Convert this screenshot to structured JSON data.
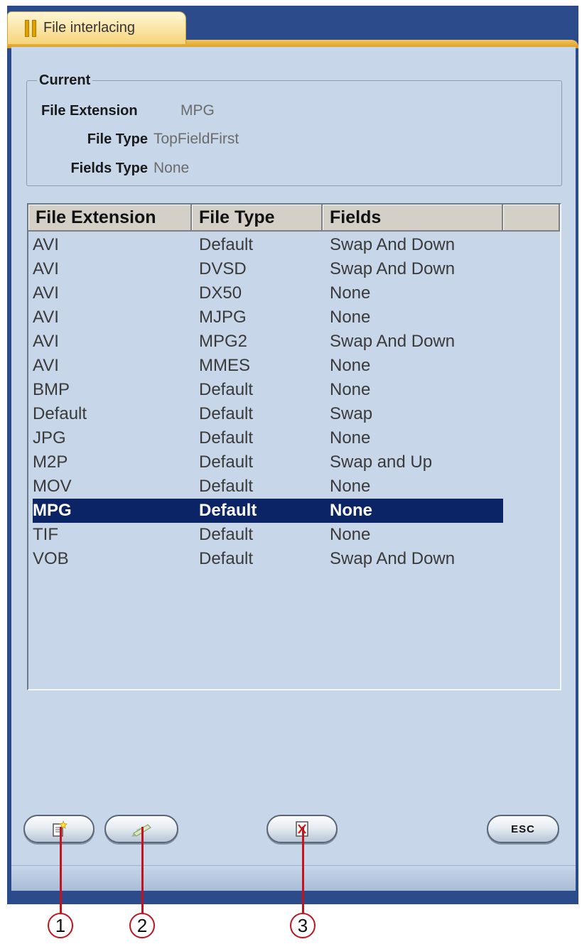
{
  "tab": {
    "title": "File interlacing"
  },
  "current": {
    "legend": "Current",
    "fields": [
      {
        "label": "File Extension",
        "value": "MPG"
      },
      {
        "label": "File Type",
        "value": "TopFieldFirst"
      },
      {
        "label": "Fields Type",
        "value": "None"
      }
    ]
  },
  "table": {
    "columns": [
      "File Extension",
      "File Type",
      "Fields"
    ],
    "selected_index": 11,
    "rows": [
      [
        "AVI",
        "Default",
        "Swap And Down"
      ],
      [
        "AVI",
        "DVSD",
        "Swap And Down"
      ],
      [
        "AVI",
        "DX50",
        "None"
      ],
      [
        "AVI",
        "MJPG",
        "None"
      ],
      [
        "AVI",
        "MPG2",
        "Swap And Down"
      ],
      [
        "AVI",
        "MMES",
        "None"
      ],
      [
        "BMP",
        "Default",
        "None"
      ],
      [
        "Default",
        "Default",
        "Swap"
      ],
      [
        "JPG",
        "Default",
        "None"
      ],
      [
        "M2P",
        "Default",
        "Swap and Up"
      ],
      [
        "MOV",
        "Default",
        "None"
      ],
      [
        "MPG",
        "Default",
        "None"
      ],
      [
        "TIF",
        "Default",
        "None"
      ],
      [
        "VOB",
        "Default",
        "Swap And Down"
      ]
    ]
  },
  "buttons": {
    "new": {
      "icon": "new-document-icon"
    },
    "edit": {
      "icon": "edit-pencil-icon"
    },
    "delete": {
      "icon": "delete-x-icon"
    },
    "esc": {
      "label": "ESC"
    }
  },
  "callouts": [
    "1",
    "2",
    "3"
  ],
  "colors": {
    "panel": "#c7d6e8",
    "selection": "#0a2466",
    "tab": "#f6d47a",
    "callout": "#c4131e"
  }
}
